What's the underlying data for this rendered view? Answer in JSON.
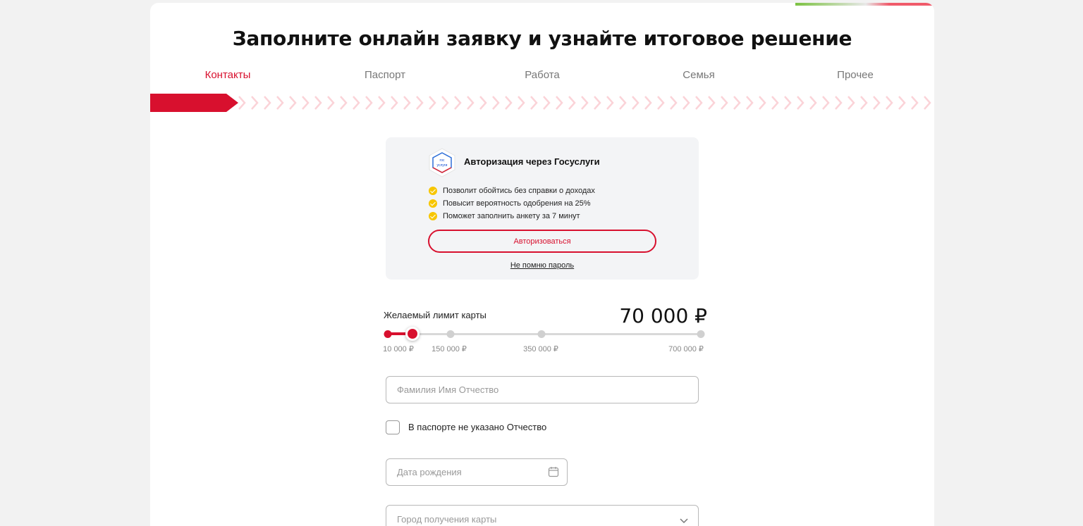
{
  "form": {
    "title": "Заполните онлайн заявку и узнайте итоговое решение",
    "steps": [
      {
        "label": "Контакты",
        "active": true
      },
      {
        "label": "Паспорт",
        "active": false
      },
      {
        "label": "Работа",
        "active": false
      },
      {
        "label": "Семья",
        "active": false
      },
      {
        "label": "Прочее",
        "active": false
      }
    ]
  },
  "gosuslugi": {
    "logo_text_1": "гос",
    "logo_text_2": "услуги",
    "title": "Авторизация через Госуслуги",
    "benefits": [
      "Позволит обойтись без справки о доходах",
      "Повысит вероятность одобрения на 25%",
      "Поможет заполнить анкету за 7 минут"
    ],
    "auth_button": "Авторизоваться",
    "forgot_link": "Не помню пароль"
  },
  "limit": {
    "label": "Желаемый лимит карты",
    "value": "70 000 ₽",
    "selected": 70000,
    "ticks": [
      "10 000 ₽",
      "150 000 ₽",
      "350 000 ₽",
      "700 000 ₽"
    ]
  },
  "fields": {
    "fio_placeholder": "Фамилия Имя Отчество",
    "no_patronymic_label": "В паспорте не указано Отчество",
    "dob_placeholder": "Дата рождения",
    "city_placeholder": "Город получения карты"
  },
  "colors": {
    "accent": "#d8102e",
    "bullet": "#f7c600"
  },
  "icons": {
    "logo": "gosuslugi-logo-icon",
    "check": "check-icon",
    "calendar": "calendar-icon",
    "dropdown": "chevron-down-icon"
  }
}
